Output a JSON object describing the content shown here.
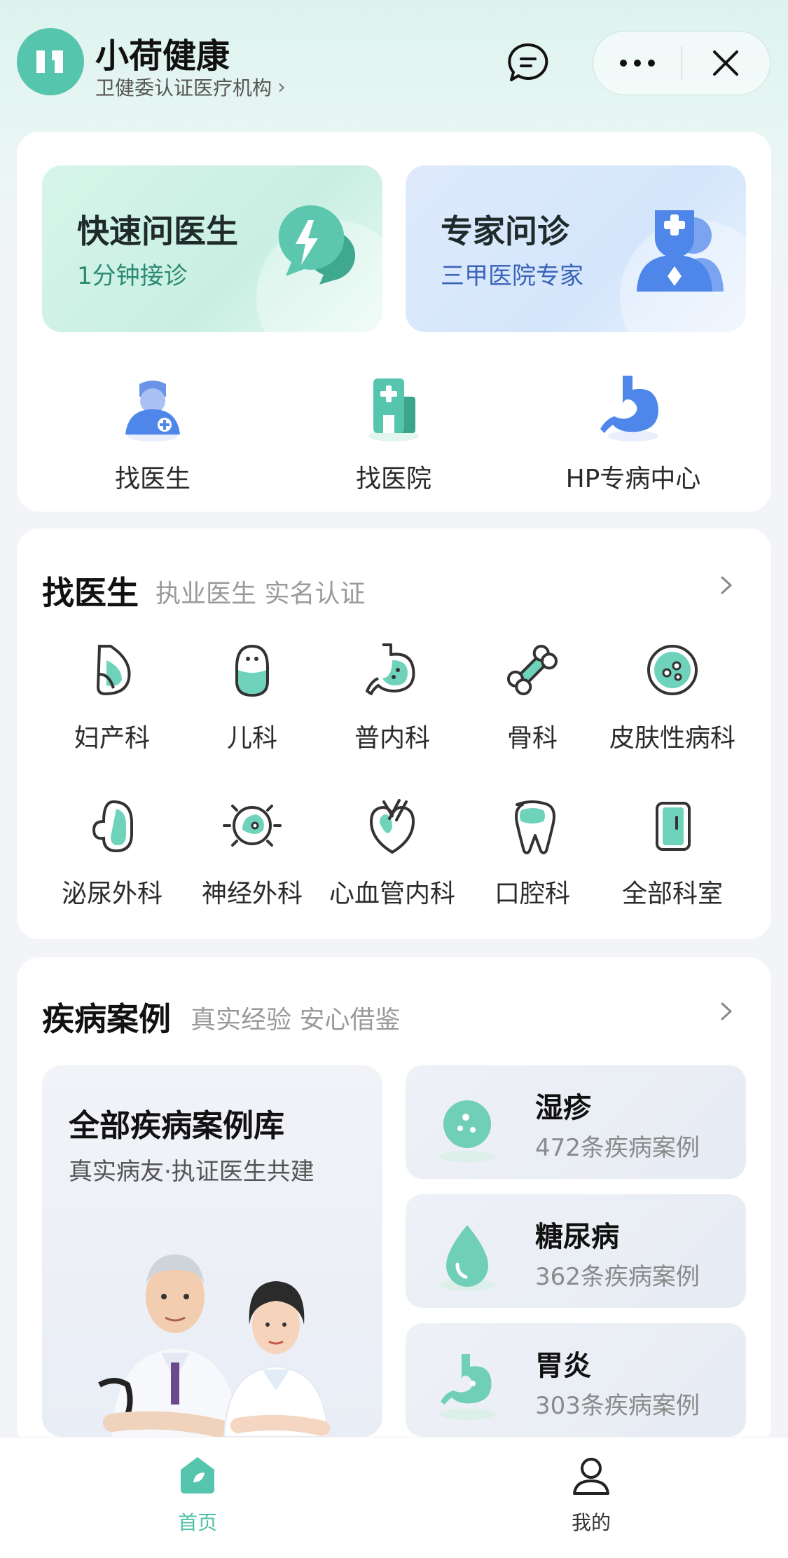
{
  "header": {
    "title": "小荷健康",
    "subtitle": "卫健委认证医疗机构",
    "subtitle_chevron": "›"
  },
  "promos": {
    "left": {
      "title": "快速问医生",
      "subtitle": "1分钟接诊",
      "icon": "lightning-chat-icon"
    },
    "right": {
      "title": "专家问诊",
      "subtitle": "三甲医院专家",
      "icon": "doctor-icon"
    }
  },
  "quick": [
    {
      "label": "找医生",
      "icon": "doctor-avatar-icon"
    },
    {
      "label": "找医院",
      "icon": "hospital-icon"
    },
    {
      "label": "HP专病中心",
      "icon": "stomach-icon"
    }
  ],
  "find_doctor": {
    "title": "找医生",
    "subtitle": "执业医生 实名认证",
    "departments": [
      {
        "label": "妇产科",
        "icon": "obstetrics-icon"
      },
      {
        "label": "儿科",
        "icon": "pediatrics-icon"
      },
      {
        "label": "普内科",
        "icon": "internal-medicine-icon"
      },
      {
        "label": "骨科",
        "icon": "bone-icon"
      },
      {
        "label": "皮肤性病科",
        "icon": "dermatology-icon"
      },
      {
        "label": "泌尿外科",
        "icon": "kidney-icon"
      },
      {
        "label": "神经外科",
        "icon": "brain-icon"
      },
      {
        "label": "心血管内科",
        "icon": "heart-icon"
      },
      {
        "label": "口腔科",
        "icon": "tooth-icon"
      },
      {
        "label": "全部科室",
        "icon": "all-departments-icon"
      }
    ]
  },
  "cases": {
    "title": "疾病案例",
    "subtitle": "真实经验 安心借鉴",
    "library": {
      "title": "全部疾病案例库",
      "subtitle": "真实病友·执证医生共建"
    },
    "items": [
      {
        "title": "湿疹",
        "count": "472条疾病案例",
        "icon": "skin-dots-icon"
      },
      {
        "title": "糖尿病",
        "count": "362条疾病案例",
        "icon": "blood-drop-icon"
      },
      {
        "title": "胃炎",
        "count": "303条疾病案例",
        "icon": "stomach-icon"
      }
    ]
  },
  "tabbar": {
    "home": "首页",
    "mine": "我的"
  },
  "colors": {
    "brand": "#56c5ad",
    "accent_blue": "#4f86ea"
  }
}
